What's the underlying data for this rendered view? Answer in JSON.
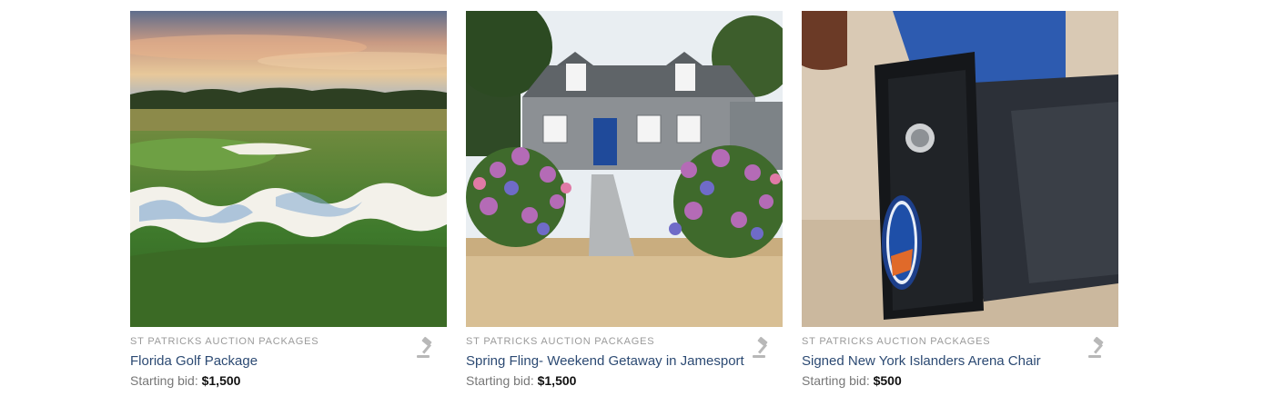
{
  "listings": [
    {
      "category": "ST PATRICKS AUCTION PACKAGES",
      "title": "Florida Golf Package",
      "bid_label": "Starting bid:",
      "bid_amount": "$1,500",
      "image_icon": "golf-course-photo",
      "action_icon": "gavel-icon"
    },
    {
      "category": "ST PATRICKS AUCTION PACKAGES",
      "title": "Spring Fling- Weekend Getaway in Jamesport",
      "bid_label": "Starting bid:",
      "bid_amount": "$1,500",
      "image_icon": "house-hydrangeas-photo",
      "action_icon": "gavel-icon"
    },
    {
      "category": "ST PATRICKS AUCTION PACKAGES",
      "title": "Signed New York Islanders Arena Chair",
      "bid_label": "Starting bid:",
      "bid_amount": "$500",
      "image_icon": "arena-chair-photo",
      "action_icon": "gavel-icon"
    }
  ],
  "colors": {
    "title": "#2c4a73",
    "category": "#9a9a9a",
    "bid_label": "#777777",
    "bid_amount": "#111111",
    "icon": "#b8b8b8"
  }
}
